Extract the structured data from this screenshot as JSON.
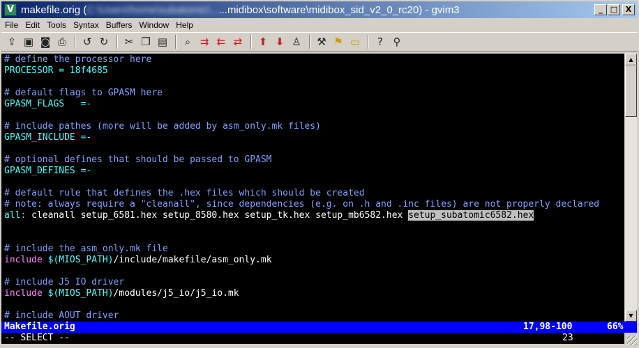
{
  "window": {
    "title_prefix": "makefile.orig (",
    "title_blurred": "C:\\Users\\home\\subatomic\\...",
    "title_suffix": "...midibox\\software\\midibox_sid_v2_0_rc20) - gvim3",
    "controls": {
      "minimize": "_",
      "maximize": "□",
      "close": "X"
    }
  },
  "menu": [
    "File",
    "Edit",
    "Tools",
    "Syntax",
    "Buffers",
    "Window",
    "Help"
  ],
  "toolbar": {
    "icons": [
      "open-icon",
      "save-icon",
      "save-all-icon",
      "print-icon",
      "sep",
      "undo-icon",
      "redo-icon",
      "sep",
      "cut-icon",
      "copy-icon",
      "paste-icon",
      "sep",
      "find-icon",
      "find-next-icon",
      "find-prev-icon",
      "replace-icon",
      "sep",
      "load-session-icon",
      "save-session-icon",
      "run-script-icon",
      "sep",
      "make-icon",
      "shell-icon",
      "ctags-icon",
      "sep",
      "help-icon",
      "find-help-icon"
    ]
  },
  "editor": {
    "lines": [
      {
        "parts": [
          {
            "t": "# define the processor here",
            "c": "comment"
          }
        ]
      },
      {
        "parts": [
          {
            "t": "PROCESSOR = 18f4685",
            "c": "ident"
          }
        ]
      },
      {
        "parts": []
      },
      {
        "parts": [
          {
            "t": "# default flags to GPASM here",
            "c": "comment"
          }
        ]
      },
      {
        "parts": [
          {
            "t": "GPASM_FLAGS   =-",
            "c": "ident"
          }
        ]
      },
      {
        "parts": []
      },
      {
        "parts": [
          {
            "t": "# include pathes (more will be added by asm_only.mk files)",
            "c": "comment"
          }
        ]
      },
      {
        "parts": [
          {
            "t": "GPASM_INCLUDE =-",
            "c": "ident"
          }
        ]
      },
      {
        "parts": []
      },
      {
        "parts": [
          {
            "t": "# optional defines that should be passed to GPASM",
            "c": "comment"
          }
        ]
      },
      {
        "parts": [
          {
            "t": "GPASM_DEFINES =-",
            "c": "ident"
          }
        ]
      },
      {
        "parts": []
      },
      {
        "parts": [
          {
            "t": "# default rule that defines the .hex files which should be created",
            "c": "comment"
          }
        ]
      },
      {
        "parts": [
          {
            "t": "# note: always require a \"cleanall\", since dependencies (e.g. on .h and .inc files) are not properly declared",
            "c": "comment"
          }
        ]
      },
      {
        "parts": [
          {
            "t": "all: ",
            "c": "ident"
          },
          {
            "t": "cleanall setup_6581.hex setup_8580.hex setup_tk.hex setup_mb6582.hex ",
            "c": "white"
          },
          {
            "t": "setup_subatomic6582.hex",
            "c": "hl"
          }
        ]
      },
      {
        "parts": []
      },
      {
        "parts": []
      },
      {
        "parts": [
          {
            "t": "# include the asm_only.mk file",
            "c": "comment"
          }
        ]
      },
      {
        "parts": [
          {
            "t": "include ",
            "c": "pink"
          },
          {
            "t": "$(MIOS_PATH)",
            "c": "ident"
          },
          {
            "t": "/include/makefile/asm_only.mk",
            "c": "white"
          }
        ]
      },
      {
        "parts": []
      },
      {
        "parts": [
          {
            "t": "# include J5 IO driver",
            "c": "comment"
          }
        ]
      },
      {
        "parts": [
          {
            "t": "include ",
            "c": "pink"
          },
          {
            "t": "$(MIOS_PATH)",
            "c": "ident"
          },
          {
            "t": "/modules/j5_io/j5_io.mk",
            "c": "white"
          }
        ]
      },
      {
        "parts": []
      },
      {
        "parts": [
          {
            "t": "# include AOUT driver",
            "c": "comment"
          }
        ]
      }
    ]
  },
  "statusline": {
    "filename": "Makefile.orig",
    "position": "17,98-100",
    "percent": "66%"
  },
  "cmdline": {
    "mode": "-- SELECT --",
    "count": "23"
  }
}
